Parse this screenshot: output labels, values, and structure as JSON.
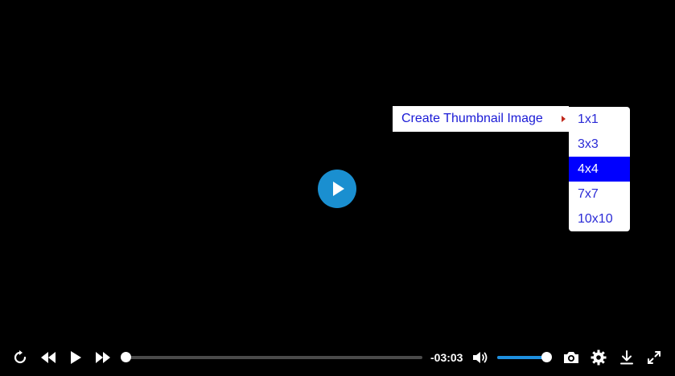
{
  "player": {
    "accent_color": "#1a8fd0",
    "background_color": "#000000",
    "big_play_icon": "play-icon"
  },
  "context_menu": {
    "label": "Create Thumbnail Image",
    "submenu_arrow_icon": "caret-right-icon",
    "submenu_items": [
      {
        "label": "1x1",
        "selected": false
      },
      {
        "label": "3x3",
        "selected": false
      },
      {
        "label": "4x4",
        "selected": true
      },
      {
        "label": "7x7",
        "selected": false
      },
      {
        "label": "10x10",
        "selected": false
      }
    ]
  },
  "controls": {
    "time_remaining": "-03:03",
    "progress_fraction": 0.0,
    "volume_fraction": 1.0,
    "icons": [
      "restart-icon",
      "rewind-icon",
      "play-icon",
      "fast-forward-icon",
      "volume-icon",
      "camera-icon",
      "gear-icon",
      "download-icon",
      "fullscreen-icon"
    ]
  }
}
